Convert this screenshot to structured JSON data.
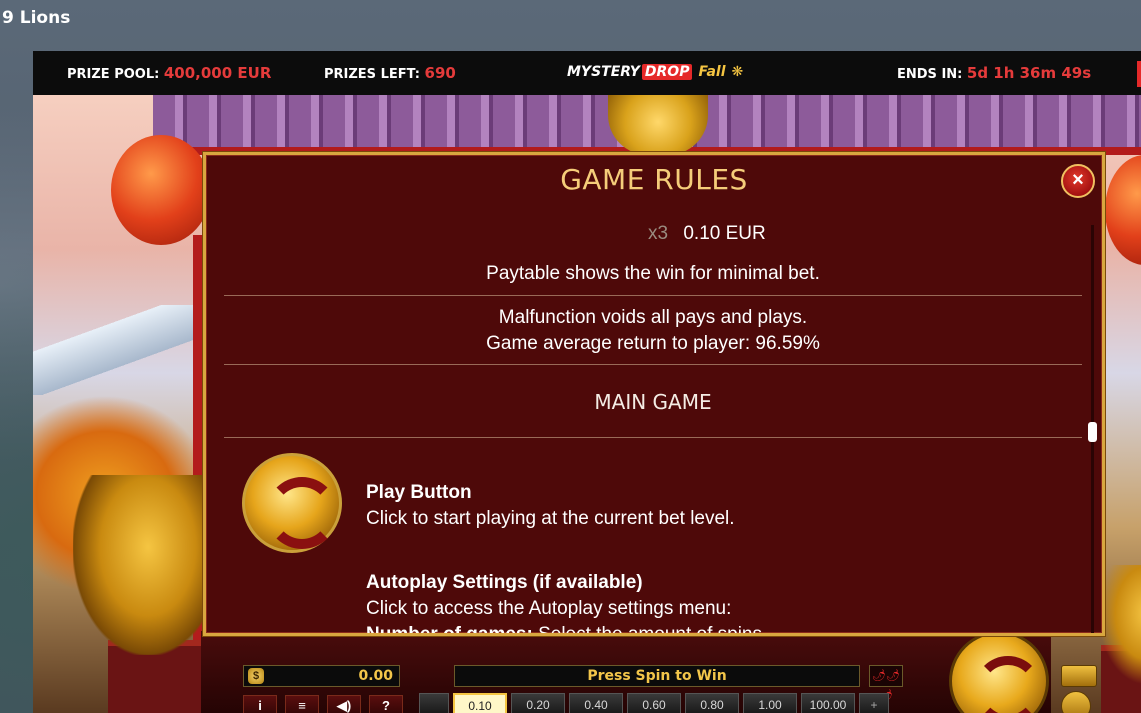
{
  "page": {
    "title": "9 Lions"
  },
  "promo": {
    "prize_pool_label": "PRIZE POOL:",
    "prize_pool_value": "400,000 EUR",
    "prizes_left_label": "PRIZES LEFT:",
    "prizes_left_value": "690",
    "logo_mystery": "MYSTERY",
    "logo_drop": "DROP",
    "logo_fall": "Fall",
    "ends_in_label": "ENDS IN:",
    "ends_in_value": "5d 1h 36m 49s"
  },
  "modal": {
    "title": "GAME RULES",
    "close_icon": "×",
    "pay_multiplier": "x3",
    "pay_value": "0.10 EUR",
    "paytable_note": "Paytable shows the win for minimal bet.",
    "malfunction": "Malfunction voids all pays and plays.",
    "rtp": "Game average return to player: 96.59%",
    "section_main": "MAIN GAME",
    "play_title": "Play Button",
    "play_desc": "Click to start playing at the current bet level.",
    "auto_title": "Autoplay Settings (if available)",
    "auto_desc": "Click to access the Autoplay settings menu:",
    "auto_more_bold": "Number of games:",
    "auto_more_rest": " Select the amount of spins"
  },
  "controls": {
    "balance_icon": "$",
    "balance": "0.00",
    "status": "Press Spin to Win",
    "chili": "🌶🌶🌶",
    "info": "i",
    "lines": "≡",
    "sound": "◀)",
    "help": "?",
    "bets": [
      "0.10",
      "0.20",
      "0.40",
      "0.60",
      "0.80",
      "1.00",
      "100.00"
    ],
    "selected_bet": "0.10",
    "bet_prev": "",
    "bet_next": "+"
  },
  "colors": {
    "accent_gold": "#f5cd7a",
    "promo_red": "#e53b3b",
    "modal_bg": "#4e0909"
  }
}
